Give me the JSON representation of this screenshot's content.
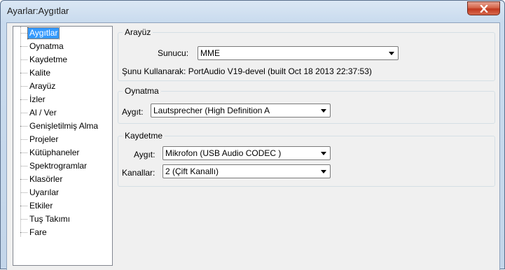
{
  "window": {
    "title": "Ayarlar:Aygıtlar"
  },
  "sidebar": {
    "items": [
      {
        "label": "Aygıtlar",
        "selected": true
      },
      {
        "label": "Oynatma"
      },
      {
        "label": "Kaydetme"
      },
      {
        "label": "Kalite"
      },
      {
        "label": "Arayüz"
      },
      {
        "label": "İzler"
      },
      {
        "label": "Al / Ver"
      },
      {
        "label": "Genişletilmiş Alma"
      },
      {
        "label": "Projeler"
      },
      {
        "label": "Kütüphaneler"
      },
      {
        "label": "Spektrogramlar"
      },
      {
        "label": "Klasörler"
      },
      {
        "label": "Uyarılar"
      },
      {
        "label": "Etkiler"
      },
      {
        "label": "Tuş Takımı"
      },
      {
        "label": "Fare"
      }
    ]
  },
  "interface": {
    "group_title": "Arayüz",
    "host_label": "Sunucu:",
    "host_value": "MME",
    "using_text": "Şunu Kullanarak: PortAudio V19-devel (built Oct 18 2013 22:37:53)"
  },
  "playback": {
    "group_title": "Oynatma",
    "device_label": "Aygıt:",
    "device_value": "Lautsprecher (High Definition A"
  },
  "recording": {
    "group_title": "Kaydetme",
    "device_label": "Aygıt:",
    "device_value": "Mikrofon (USB Audio CODEC )",
    "channels_label": "Kanallar:",
    "channels_value": "2 (Çift Kanallı)"
  },
  "colors": {
    "selection": "#3399ff",
    "close_button": "#c74a30"
  }
}
